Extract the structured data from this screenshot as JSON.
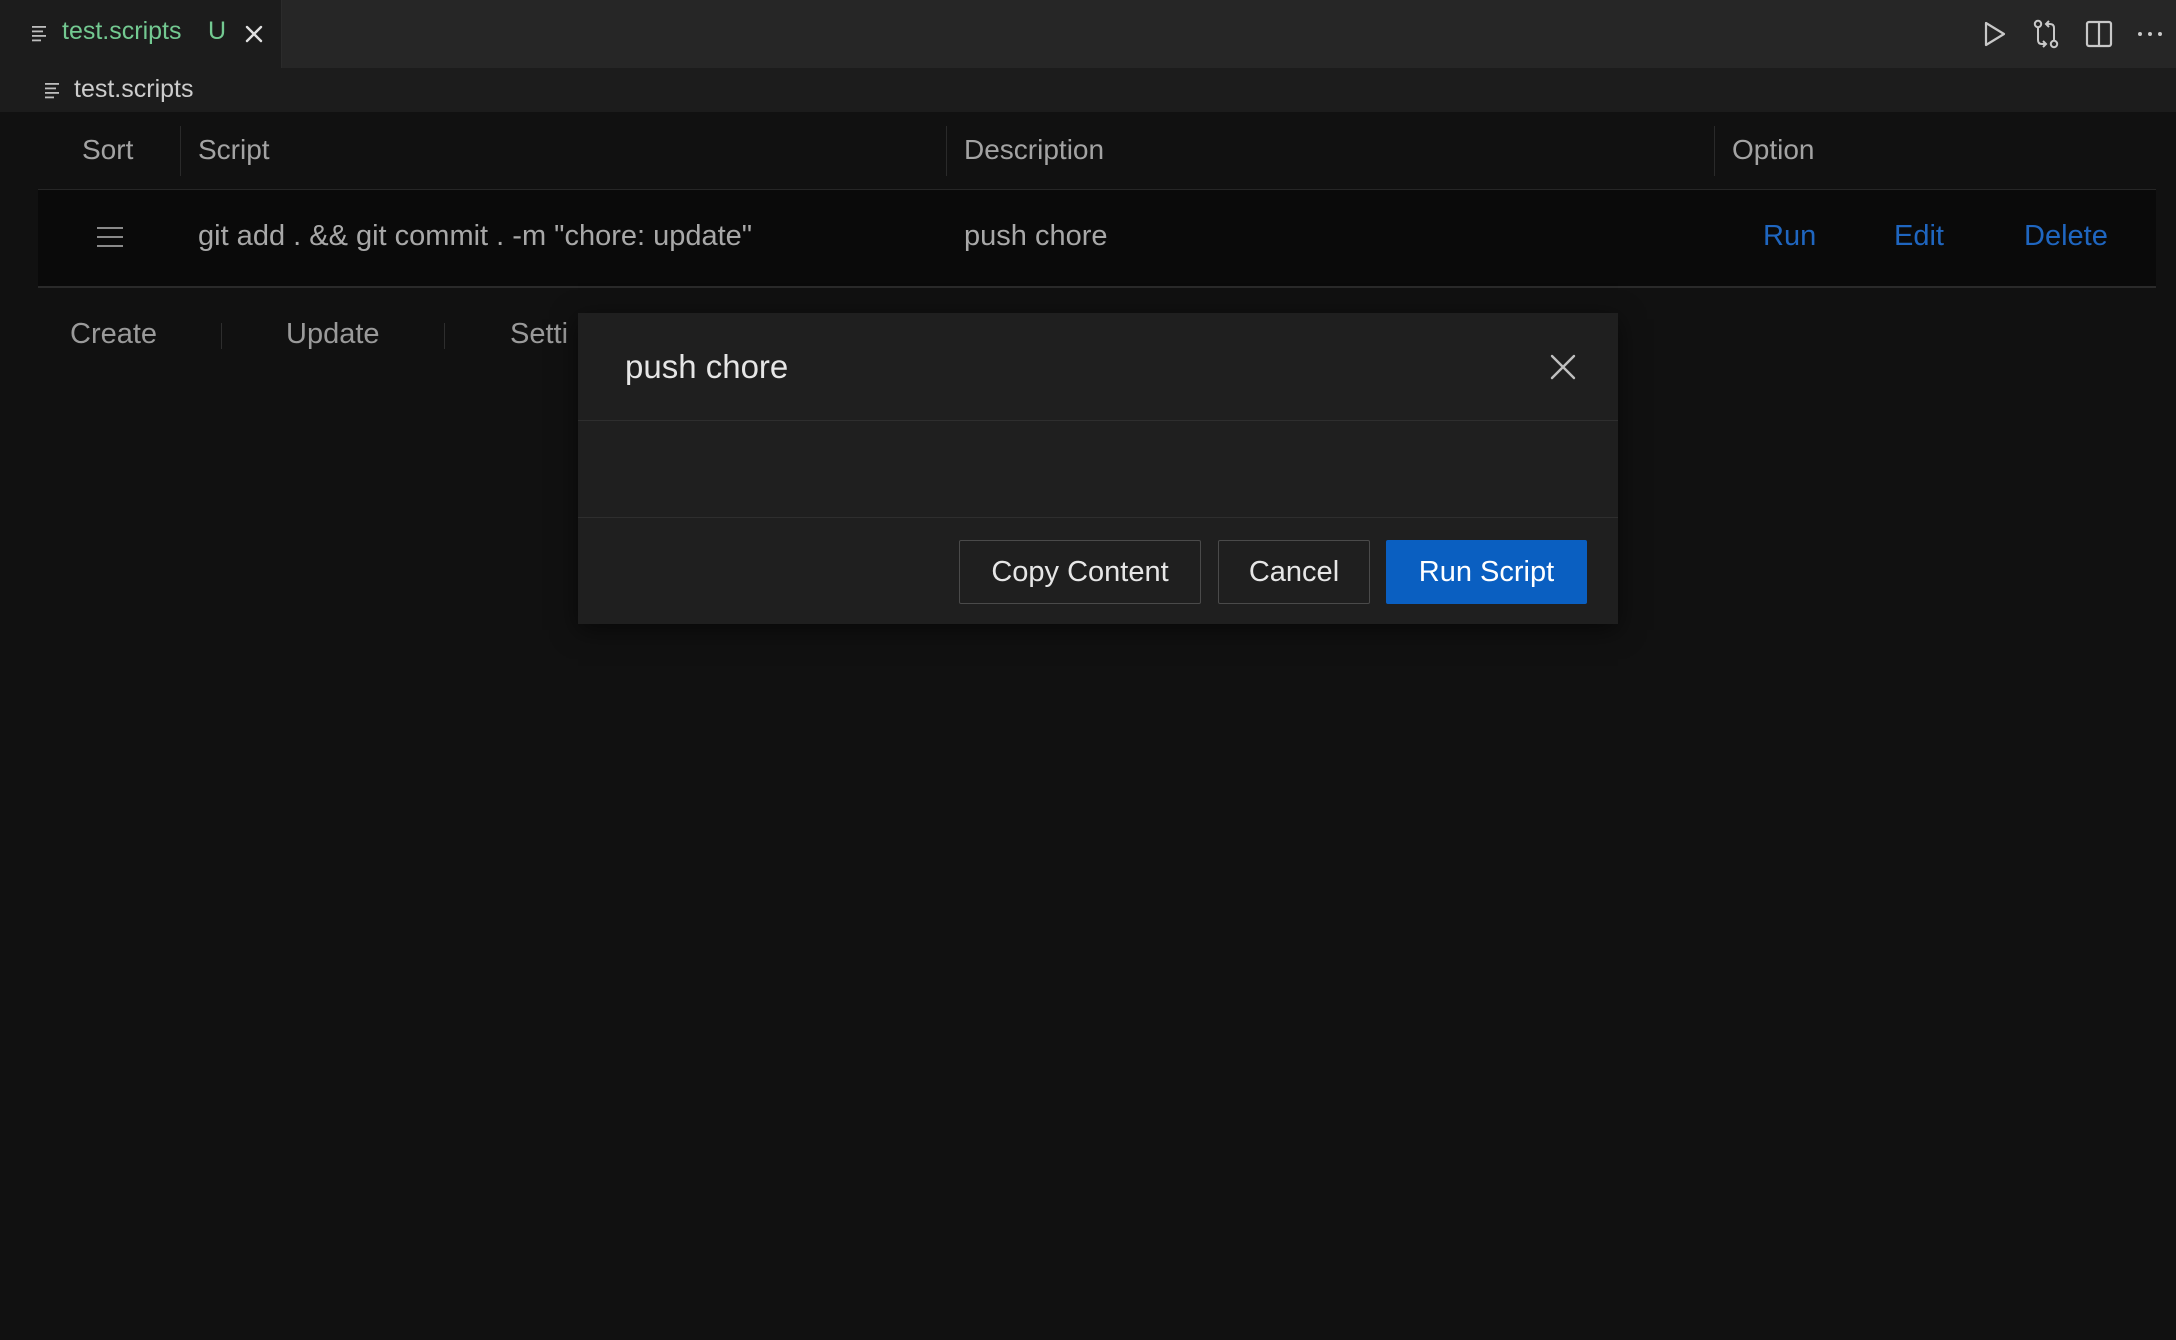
{
  "tab": {
    "label": "test.scripts",
    "badge": "U",
    "icon": "file-lines-icon"
  },
  "editor_actions": [
    "run-icon",
    "source-control-compare-icon",
    "split-editor-icon",
    "more-actions-icon"
  ],
  "breadcrumb": {
    "label": "test.scripts"
  },
  "table": {
    "headers": [
      "Sort",
      "Script",
      "Description",
      "Option"
    ],
    "rows": [
      {
        "script": "git add . && git commit . -m \"chore: update\"",
        "description": "push chore",
        "options": [
          "Run",
          "Edit",
          "Delete"
        ]
      }
    ]
  },
  "toolbar": {
    "create": "Create",
    "update": "Update",
    "settings": "Setti"
  },
  "modal": {
    "title": "push chore",
    "body": "",
    "buttons": {
      "copy": "Copy Content",
      "cancel": "Cancel",
      "run": "Run Script"
    }
  },
  "colors": {
    "background": "#111111",
    "tab_active_text": "#73c991",
    "link": "#1f66c0",
    "primary_button": "#0a5fc1"
  }
}
